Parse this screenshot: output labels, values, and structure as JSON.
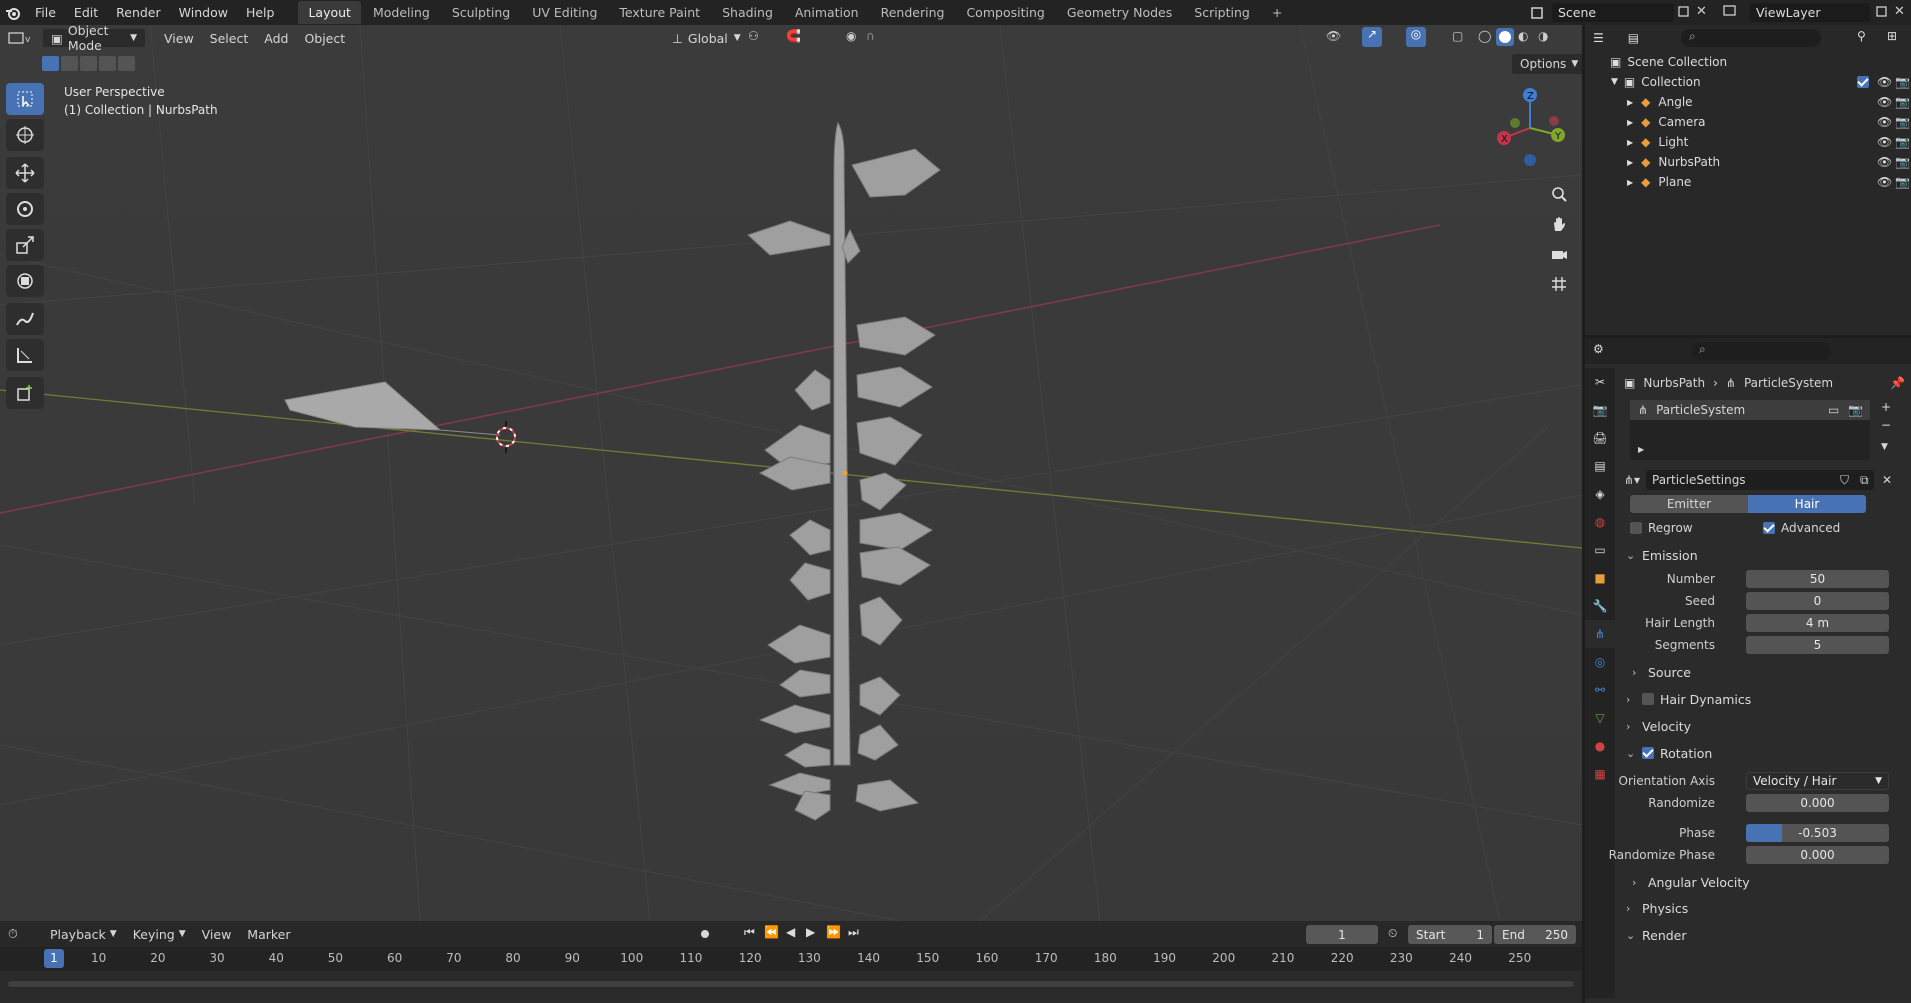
{
  "topbar": {
    "menus": [
      "File",
      "Edit",
      "Render",
      "Window",
      "Help"
    ],
    "workspaces": [
      "Layout",
      "Modeling",
      "Sculpting",
      "UV Editing",
      "Texture Paint",
      "Shading",
      "Animation",
      "Rendering",
      "Compositing",
      "Geometry Nodes",
      "Scripting"
    ],
    "active_workspace": "Layout",
    "add_workspace": "+",
    "scene": "Scene",
    "view_layer": "ViewLayer"
  },
  "viewport": {
    "mode": "Object Mode",
    "menus": [
      "View",
      "Select",
      "Add",
      "Object"
    ],
    "orientation": "Global",
    "options": "Options",
    "perspective": "User Perspective",
    "context": "(1) Collection | NurbsPath",
    "gizmo": {
      "x": "X",
      "y": "Y",
      "z": "Z"
    },
    "colors": {
      "x_axis": "#c4344c",
      "y_axis": "#7fa72b",
      "z_axis": "#3f80d6",
      "grid": "#444444",
      "mesh": "#9e9e9e"
    }
  },
  "timeline": {
    "menus": [
      "Playback",
      "Keying",
      "View",
      "Marker"
    ],
    "current_frame": "1",
    "start_label": "Start",
    "start": "1",
    "end_label": "End",
    "end": "250",
    "ticks": [
      "10",
      "20",
      "30",
      "40",
      "50",
      "60",
      "70",
      "80",
      "90",
      "100",
      "110",
      "120",
      "130",
      "140",
      "150",
      "160",
      "170",
      "180",
      "190",
      "200",
      "210",
      "220",
      "230",
      "240",
      "250"
    ],
    "cursor_frame": "1"
  },
  "outliner": {
    "root": "Scene Collection",
    "collection": "Collection",
    "objects": [
      {
        "name": "Angle",
        "icon": "curve-icon",
        "color": "#e89c3a"
      },
      {
        "name": "Camera",
        "icon": "camera-icon",
        "color": "#e89c3a"
      },
      {
        "name": "Light",
        "icon": "light-icon",
        "color": "#e89c3a"
      },
      {
        "name": "NurbsPath",
        "icon": "curve-icon",
        "color": "#e89c3a"
      },
      {
        "name": "Plane",
        "icon": "mesh-icon",
        "color": "#e89c3a"
      }
    ]
  },
  "properties": {
    "breadcrumb_object": "NurbsPath",
    "breadcrumb_system": "ParticleSystem",
    "system_name": "ParticleSystem",
    "settings_name": "ParticleSettings",
    "type_emitter": "Emitter",
    "type_hair": "Hair",
    "regrow": "Regrow",
    "advanced": "Advanced",
    "emission": {
      "title": "Emission",
      "number_label": "Number",
      "number": "50",
      "seed_label": "Seed",
      "seed": "0",
      "hair_length_label": "Hair Length",
      "hair_length": "4 m",
      "segments_label": "Segments",
      "segments": "5",
      "source": "Source"
    },
    "hair_dynamics": "Hair Dynamics",
    "velocity": "Velocity",
    "rotation": {
      "title": "Rotation",
      "orientation_axis_label": "Orientation Axis",
      "orientation_axis": "Velocity / Hair",
      "randomize_label": "Randomize",
      "randomize": "0.000",
      "phase_label": "Phase",
      "phase": "-0.503",
      "phase_fill": 0.25,
      "randomize_phase_label": "Randomize Phase",
      "randomize_phase": "0.000",
      "angular_velocity": "Angular Velocity"
    },
    "physics": "Physics",
    "render": "Render",
    "accent": "#4772b3"
  }
}
